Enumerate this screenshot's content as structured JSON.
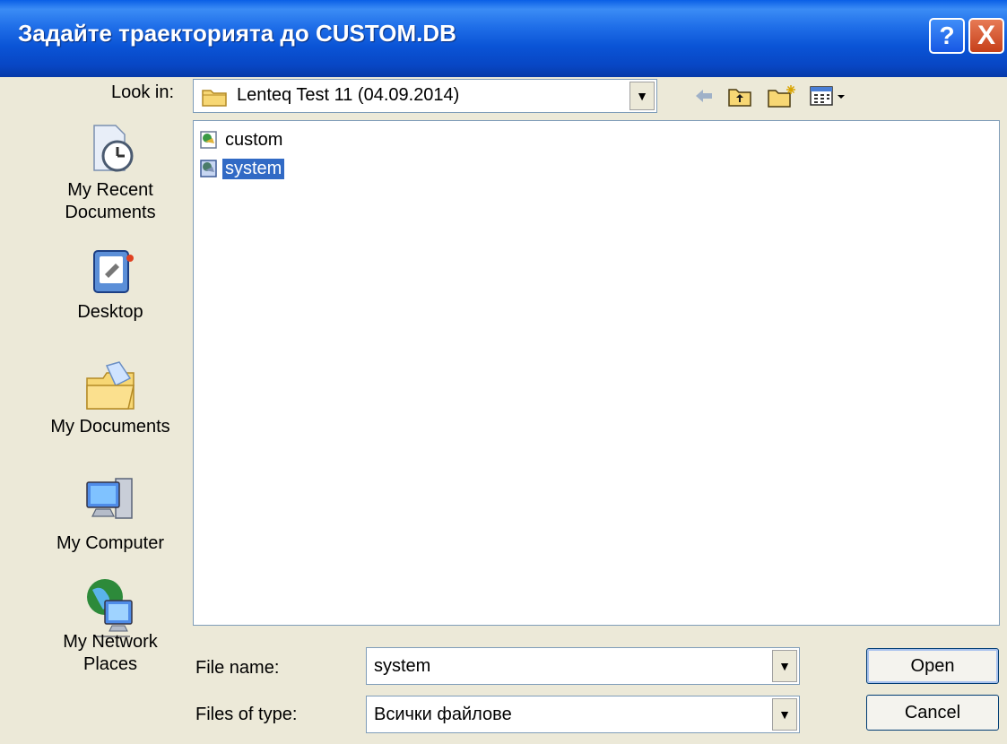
{
  "window": {
    "title": "Задайте траекторията до CUSTOM.DB",
    "help_label": "?",
    "close_label": "X"
  },
  "lookin": {
    "label": "Look in:",
    "value": "Lenteq Test 11 (04.09.2014)"
  },
  "toolbar": {
    "icons": [
      "back-arrow-icon",
      "up-folder-icon",
      "new-folder-icon",
      "views-menu-icon"
    ]
  },
  "places": [
    {
      "name": "recent",
      "label": "My Recent\nDocuments",
      "icon": "recent-documents-icon"
    },
    {
      "name": "desktop",
      "label": "Desktop",
      "icon": "desktop-icon"
    },
    {
      "name": "documents",
      "label": "My Documents",
      "icon": "my-documents-icon"
    },
    {
      "name": "computer",
      "label": "My Computer",
      "icon": "my-computer-icon"
    },
    {
      "name": "network",
      "label": "My Network\nPlaces",
      "icon": "network-places-icon"
    }
  ],
  "files": [
    {
      "name": "custom",
      "selected": false
    },
    {
      "name": "system",
      "selected": true
    }
  ],
  "filename": {
    "label": "File name:",
    "value": "system"
  },
  "filetype": {
    "label": "Files of type:",
    "value": "Всички файлове"
  },
  "buttons": {
    "open": "Open",
    "cancel": "Cancel"
  },
  "colors": {
    "titlebar": "#0a54d6",
    "selection": "#316ac5",
    "dialog_bg": "#ece9d8"
  }
}
